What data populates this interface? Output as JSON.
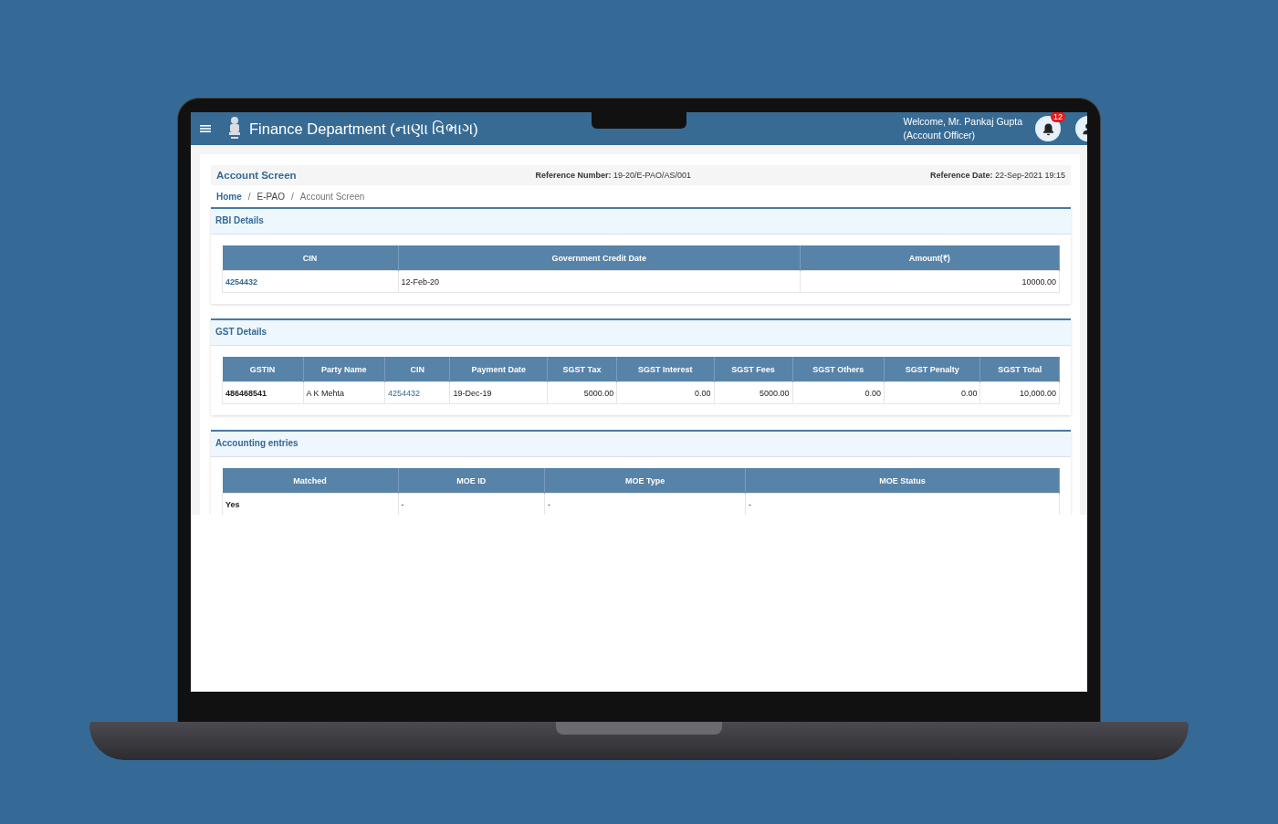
{
  "header": {
    "title": "Finance Department (નાણા વિભાગ)",
    "welcome": "Welcome, Mr. Pankaj Gupta",
    "role": "(Account Officer)",
    "notification_count": "12"
  },
  "page": {
    "title": "Account Screen",
    "reference_number": {
      "label": "Reference Number:",
      "value": "19-20/E-PAO/AS/001"
    },
    "reference_date": {
      "label": "Reference Date:",
      "value": "22-Sep-2021 19:15"
    }
  },
  "breadcrumb": [
    {
      "label": "Home",
      "kind": "link"
    },
    {
      "separator": "/",
      "label": "E-PAO",
      "kind": "plain"
    },
    {
      "separator": "/",
      "label": "Account Screen",
      "kind": "current"
    }
  ],
  "sections": [
    {
      "title": "RBI Details",
      "columns": [
        {
          "label": "CIN",
          "kind": "link-bold"
        },
        {
          "label": "Government Credit Date",
          "kind": "text"
        },
        {
          "label": "Amount(₹)",
          "kind": "amount"
        }
      ],
      "rows": [
        [
          "4254432",
          "12-Feb-20",
          "10000.00"
        ]
      ]
    },
    {
      "title": "GST Details",
      "columns": [
        {
          "label": "GSTIN",
          "kind": "bold"
        },
        {
          "label": "Party Name",
          "kind": "text"
        },
        {
          "label": "CIN",
          "kind": "link"
        },
        {
          "label": "Payment Date",
          "kind": "text"
        },
        {
          "label": "SGST Tax",
          "kind": "amount"
        },
        {
          "label": "SGST Interest",
          "kind": "amount"
        },
        {
          "label": "SGST Fees",
          "kind": "amount"
        },
        {
          "label": "SGST Others",
          "kind": "amount"
        },
        {
          "label": "SGST Penalty",
          "kind": "amount"
        },
        {
          "label": "SGST Total",
          "kind": "amount"
        }
      ],
      "rows": [
        [
          "486468541",
          "A K Mehta",
          "4254432",
          "19-Dec-19",
          "5000.00",
          "0.00",
          "5000.00",
          "0.00",
          "0.00",
          "10,000.00"
        ]
      ]
    },
    {
      "title": "Accounting entries",
      "columns": [
        {
          "label": "Matched",
          "kind": "bold"
        },
        {
          "label": "MOE ID",
          "kind": "text"
        },
        {
          "label": "MOE Type",
          "kind": "text"
        },
        {
          "label": "MOE Status",
          "kind": "text"
        }
      ],
      "rows": [
        [
          "Yes",
          "-",
          "-",
          "-"
        ]
      ]
    }
  ]
}
